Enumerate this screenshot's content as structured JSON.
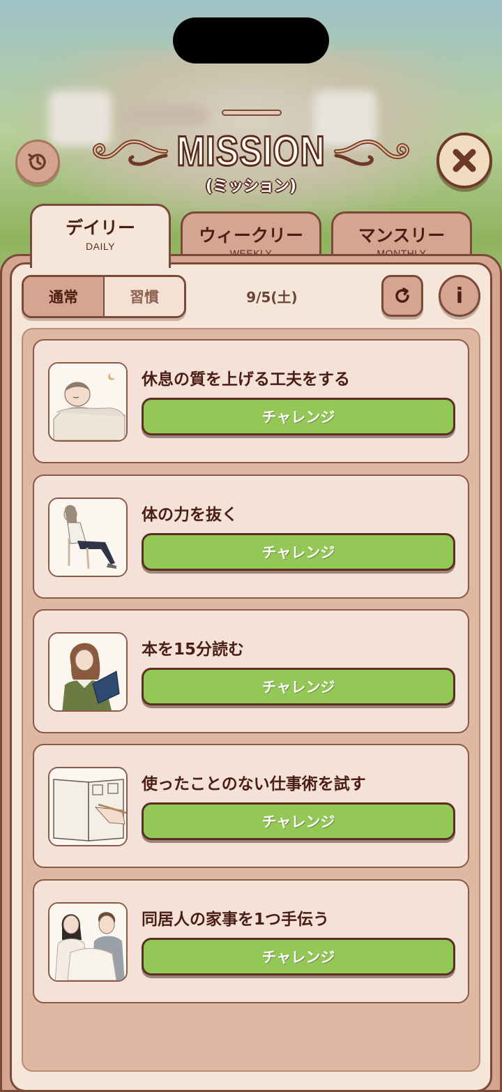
{
  "header": {
    "title": "MISSION",
    "subtitle": "(ミッション)"
  },
  "icons": {
    "history": "history-icon",
    "close": "close-icon",
    "refresh": "refresh-icon",
    "info": "info-icon"
  },
  "info_label": "i",
  "tabs": [
    {
      "label": "デイリー",
      "sub": "DAILY",
      "active": true
    },
    {
      "label": "ウィークリー",
      "sub": "WEEKLY",
      "active": false
    },
    {
      "label": "マンスリー",
      "sub": "MONTHLY",
      "active": false
    }
  ],
  "segment": {
    "normal": "通常",
    "habit": "習慣",
    "selected": "通常"
  },
  "date": "9/5(土)",
  "missions": [
    {
      "title": "休息の質を上げる工夫をする",
      "button": "チャレンジ"
    },
    {
      "title": "体の力を抜く",
      "button": "チャレンジ"
    },
    {
      "title": "本を15分読む",
      "button": "チャレンジ"
    },
    {
      "title": "使ったことのない仕事術を試す",
      "button": "チャレンジ"
    },
    {
      "title": "同居人の家事を1つ手伝う",
      "button": "チャレンジ"
    }
  ],
  "colors": {
    "accent_green": "#94c856",
    "outline_brown": "#7a4a38",
    "panel": "#f6e6da"
  }
}
